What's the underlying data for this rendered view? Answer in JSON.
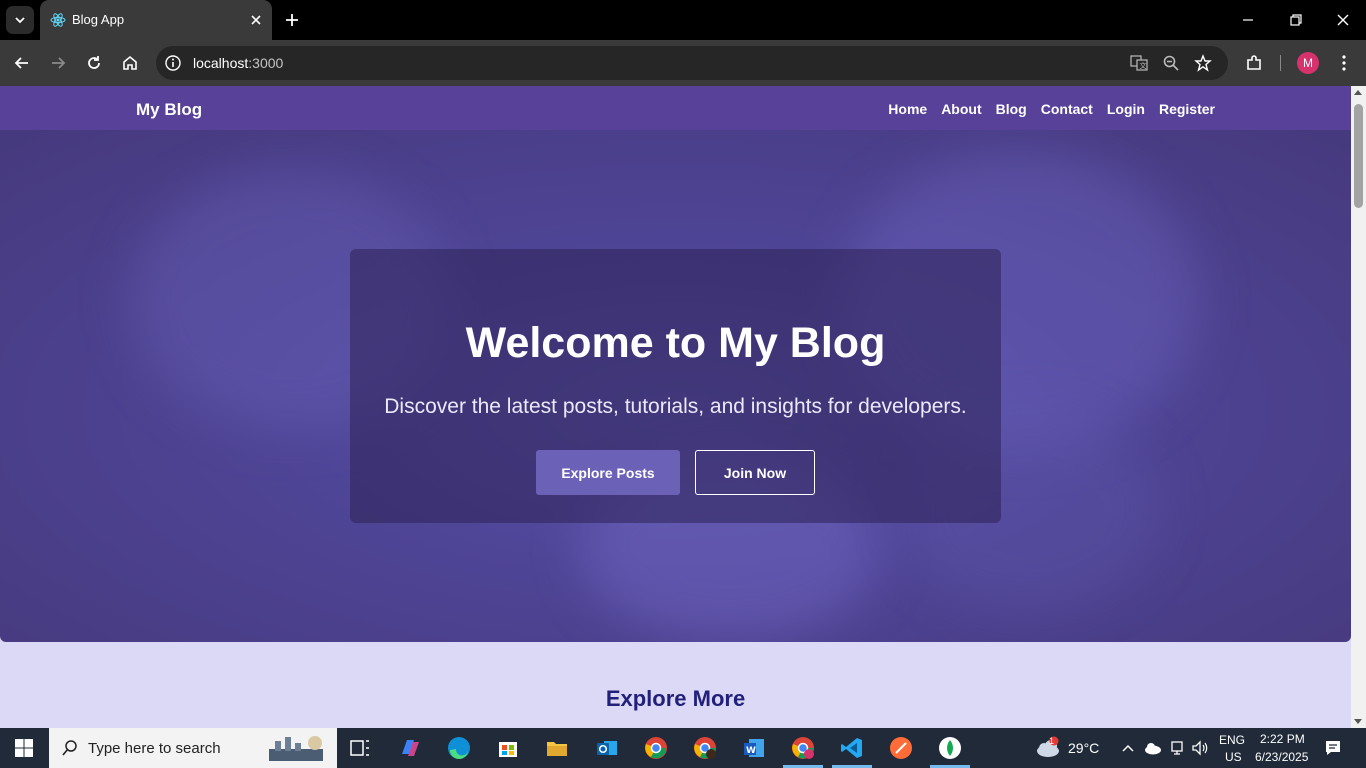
{
  "browser": {
    "tab_title": "Blog App",
    "url_host": "localhost",
    "url_port": ":3000",
    "profile_initial": "M"
  },
  "site": {
    "brand": "My Blog",
    "nav": [
      "Home",
      "About",
      "Blog",
      "Contact",
      "Login",
      "Register"
    ],
    "hero_title": "Welcome to My Blog",
    "hero_subtitle": "Discover the latest posts, tutorials, and insights for developers.",
    "explore_button": "Explore Posts",
    "join_button": "Join Now",
    "section_title": "Explore More"
  },
  "taskbar": {
    "search_placeholder": "Type here to search",
    "weather_temp": "29°C",
    "weather_badge": "1",
    "lang_top": "ENG",
    "lang_bottom": "US",
    "time": "2:22 PM",
    "date": "6/23/2025"
  },
  "colors": {
    "nav_bg": "#574199",
    "hero_bg": "#4f4597",
    "page_bg": "#dcd9f7",
    "section_title": "#23207a",
    "explore_btn": "#6b62b8"
  }
}
